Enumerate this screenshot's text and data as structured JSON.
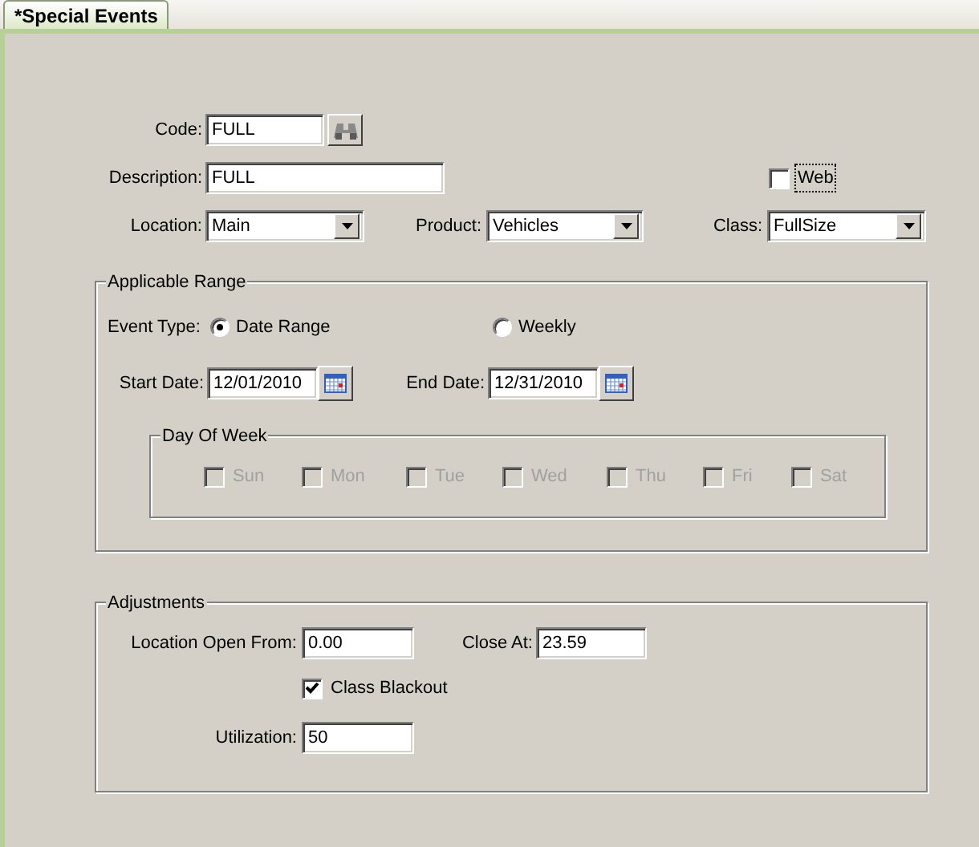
{
  "tab": {
    "label": "*Special Events",
    "selected": true
  },
  "code": {
    "label": "Code:",
    "value": "FULL"
  },
  "description": {
    "label": "Description:",
    "value": "FULL"
  },
  "web": {
    "label": "Web",
    "checked": false
  },
  "location": {
    "label": "Location:",
    "value": "Main"
  },
  "product": {
    "label": "Product:",
    "value": "Vehicles"
  },
  "class": {
    "label": "Class:",
    "value": "FullSize"
  },
  "applicable_range": {
    "title": "Applicable Range",
    "event_type": {
      "label": "Event Type:",
      "options": [
        {
          "label": "Date Range",
          "selected": true
        },
        {
          "label": "Weekly",
          "selected": false
        }
      ]
    },
    "start_date": {
      "label": "Start Date:",
      "value": "12/01/2010"
    },
    "end_date": {
      "label": "End Date:",
      "value": "12/31/2010"
    },
    "day_of_week": {
      "title": "Day Of Week",
      "days": [
        {
          "label": "Sun",
          "checked": false,
          "disabled": true
        },
        {
          "label": "Mon",
          "checked": false,
          "disabled": true
        },
        {
          "label": "Tue",
          "checked": false,
          "disabled": true
        },
        {
          "label": "Wed",
          "checked": false,
          "disabled": true
        },
        {
          "label": "Thu",
          "checked": false,
          "disabled": true
        },
        {
          "label": "Fri",
          "checked": false,
          "disabled": true
        },
        {
          "label": "Sat",
          "checked": false,
          "disabled": true
        }
      ]
    }
  },
  "adjustments": {
    "title": "Adjustments",
    "open_from": {
      "label": "Location Open From:",
      "value": "0.00"
    },
    "close_at": {
      "label": "Close At:",
      "value": "23.59"
    },
    "class_blackout": {
      "label": "Class Blackout",
      "checked": true
    },
    "utilization": {
      "label": "Utilization:",
      "value": "50"
    }
  }
}
